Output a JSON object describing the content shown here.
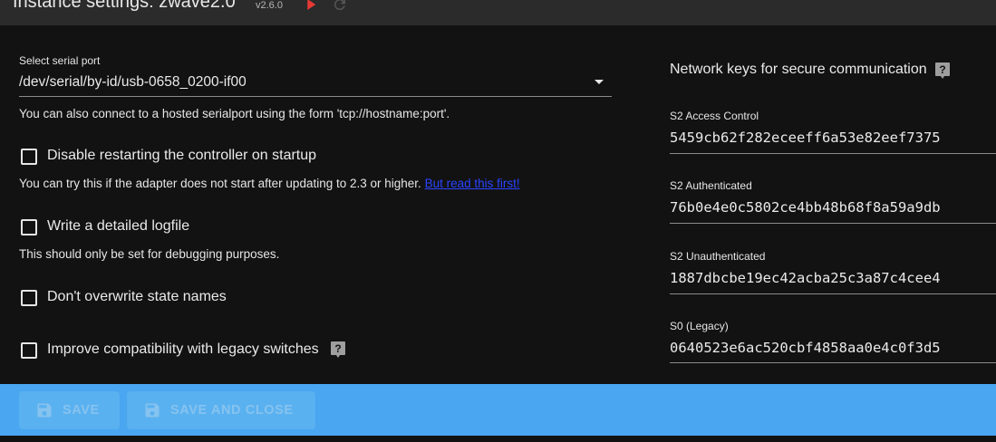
{
  "header": {
    "title": "Instance settings: zwave2.0",
    "version": "v2.6.0",
    "play_icon": "play-icon",
    "reload_icon": "reload-icon",
    "play_color": "#e53935"
  },
  "serial": {
    "label": "Select serial port",
    "value": "/dev/serial/by-id/usb-0658_0200-if00",
    "helper": "You can also connect to a hosted serialport using the form 'tcp://hostname:port'."
  },
  "options": [
    {
      "label": "Disable restarting the controller on startup",
      "checked": false,
      "helper": "You can try this if the adapter does not start after updating to 2.3 or higher.",
      "link": "But read this first!"
    },
    {
      "label": "Write a detailed logfile",
      "checked": false,
      "helper": "This should only be set for debugging purposes."
    },
    {
      "label": "Don't overwrite state names",
      "checked": false
    },
    {
      "label": "Improve compatibility with legacy switches",
      "checked": false
    }
  ],
  "keys": {
    "title": "Network keys for secure communication",
    "items": [
      {
        "label": "S2 Access Control",
        "value": "5459cb62f282eceeff6a53e82eef7375"
      },
      {
        "label": "S2 Authenticated",
        "value": "76b0e4e0c5802ce4bb48b68f8a59a9db"
      },
      {
        "label": "S2 Unauthenticated",
        "value": "1887dbcbe19ec42acba25c3a87c4cee4"
      },
      {
        "label": "S0 (Legacy)",
        "value": "0640523e6ac520cbf4858aa0e4c0f3d5"
      }
    ]
  },
  "footer": {
    "save_label": "SAVE",
    "save_close_label": "SAVE AND CLOSE",
    "save_icon": "save-icon",
    "footer_color": "#4aa6f0"
  }
}
